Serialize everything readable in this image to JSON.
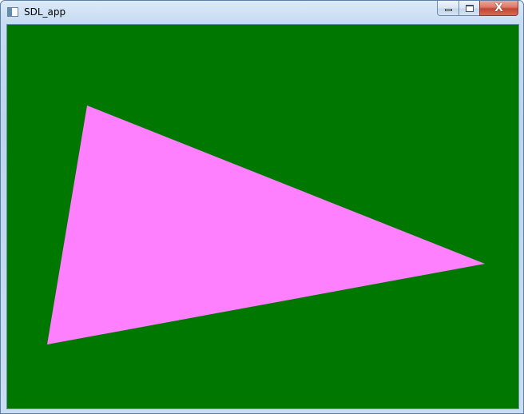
{
  "window": {
    "title": "SDL_app",
    "icon": "app-window-icon"
  },
  "caption_buttons": {
    "minimize_icon": "minimize-icon",
    "maximize_icon": "maximize-icon",
    "close_icon": "close-icon",
    "close_glyph": "X"
  },
  "canvas": {
    "background_color": "#007800",
    "shape": "triangle",
    "triangle_fill_color": "#ff80ff"
  }
}
